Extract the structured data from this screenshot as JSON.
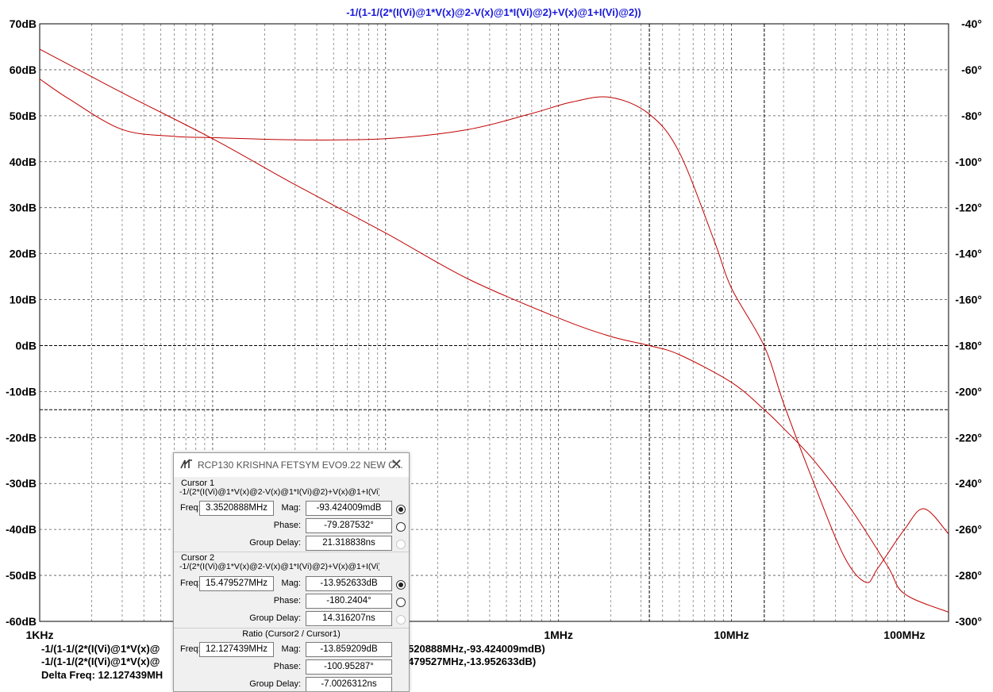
{
  "chart_data": {
    "type": "line",
    "title": "-1/(1-1/(2*(I(Vi)@1*V(x)@2-V(x)@1*I(Vi)@2)+V(x)@1+I(Vi)@2))",
    "x_scale": "log",
    "x_range_hz": [
      1000,
      180000000
    ],
    "x_tick_labels": [
      "1KHz",
      "1MHz",
      "10MHz",
      "100MHz"
    ],
    "y_left_range_db": [
      -60,
      70
    ],
    "y_left_ticks": [
      "70dB",
      "60dB",
      "50dB",
      "40dB",
      "30dB",
      "20dB",
      "10dB",
      "0dB",
      "-10dB",
      "-20dB",
      "-30dB",
      "-40dB",
      "-50dB",
      "-60dB"
    ],
    "y_right_range_deg": [
      -300,
      -40
    ],
    "y_right_ticks": [
      "-40°",
      "-60°",
      "-80°",
      "-100°",
      "-120°",
      "-140°",
      "-160°",
      "-180°",
      "-200°",
      "-220°",
      "-240°",
      "-260°",
      "-280°",
      "-300°"
    ],
    "grid": true,
    "series": [
      {
        "name": "magnitude",
        "color": "#c00000",
        "axis": "left",
        "points": [
          [
            1000,
            64.5
          ],
          [
            3000,
            55
          ],
          [
            10000,
            45
          ],
          [
            30000,
            35
          ],
          [
            100000,
            24.5
          ],
          [
            300000,
            14.5
          ],
          [
            1000000,
            6
          ],
          [
            2000000,
            2
          ],
          [
            3350000,
            0
          ],
          [
            5000000,
            -2
          ],
          [
            10000000,
            -8
          ],
          [
            15479527,
            -13.95
          ],
          [
            20000000,
            -18
          ],
          [
            30000000,
            -25
          ],
          [
            50000000,
            -36
          ],
          [
            80000000,
            -48
          ],
          [
            100000000,
            -54
          ],
          [
            180000000,
            -58
          ]
        ]
      },
      {
        "name": "phase",
        "color": "#c00000",
        "axis": "right",
        "points": [
          [
            1000,
            -64
          ],
          [
            1500,
            -73
          ],
          [
            3000,
            -86
          ],
          [
            6000,
            -89
          ],
          [
            10000,
            -89.5
          ],
          [
            30000,
            -90.5
          ],
          [
            100000,
            -90
          ],
          [
            300000,
            -86
          ],
          [
            700000,
            -79
          ],
          [
            1200000,
            -74
          ],
          [
            2000000,
            -72
          ],
          [
            3350000,
            -79.3
          ],
          [
            5000000,
            -96
          ],
          [
            8000000,
            -135
          ],
          [
            10000000,
            -155
          ],
          [
            15479527,
            -180.24
          ],
          [
            20000000,
            -205
          ],
          [
            30000000,
            -240
          ],
          [
            45000000,
            -272
          ],
          [
            60000000,
            -283
          ],
          [
            70000000,
            -277
          ],
          [
            100000000,
            -260
          ],
          [
            130000000,
            -251
          ],
          [
            180000000,
            -262
          ]
        ]
      }
    ],
    "cursor_lines": {
      "x_hz": [
        3352088.8,
        15479527
      ],
      "y_db": [
        0,
        -13.95
      ]
    }
  },
  "status": {
    "line1_left": "-1/(1-1/(2*(I(Vi)@1*V(x)@",
    "line1_right": "520888MHz,-93.424009mdB)",
    "line2_left": "-1/(1-1/(2*(I(Vi)@1*V(x)@",
    "line2_right": "479527MHz,-13.952633dB)",
    "delta": "Delta Freq: 12.127439MH"
  },
  "dialog": {
    "title": "RCP130 KRISHNA FETSYM EVO9.22 NEW C...",
    "close": "✕",
    "cursor1": {
      "heading": "Cursor 1",
      "expr": "-1/(2*(I(Vi)@1*V(x)@2-V(x)@1*I(Vi)@2)+V(x)@1+I(Vi)",
      "freq_label": "Freq:",
      "freq": "3.3520888MHz",
      "mag_label": "Mag:",
      "mag": "-93.424009mdB",
      "phase_label": "Phase:",
      "phase": "-79.287532°",
      "gd_label": "Group Delay:",
      "gd": "21.318838ns"
    },
    "cursor2": {
      "heading": "Cursor 2",
      "expr": "-1/(2*(I(Vi)@1*V(x)@2-V(x)@1*I(Vi)@2)+V(x)@1+I(Vi)",
      "freq_label": "Freq:",
      "freq": "15.479527MHz",
      "mag_label": "Mag:",
      "mag": "-13.952633dB",
      "phase_label": "Phase:",
      "phase": "-180.2404°",
      "gd_label": "Group Delay:",
      "gd": "14.316207ns"
    },
    "ratio": {
      "heading": "Ratio (Cursor2 / Cursor1)",
      "freq_label": "Freq:",
      "freq": "12.127439MHz",
      "mag_label": "Mag:",
      "mag": "-13.859209dB",
      "phase_label": "Phase:",
      "phase": "-100.95287°",
      "gd_label": "Group Delay:",
      "gd": "-7.0026312ns"
    }
  }
}
